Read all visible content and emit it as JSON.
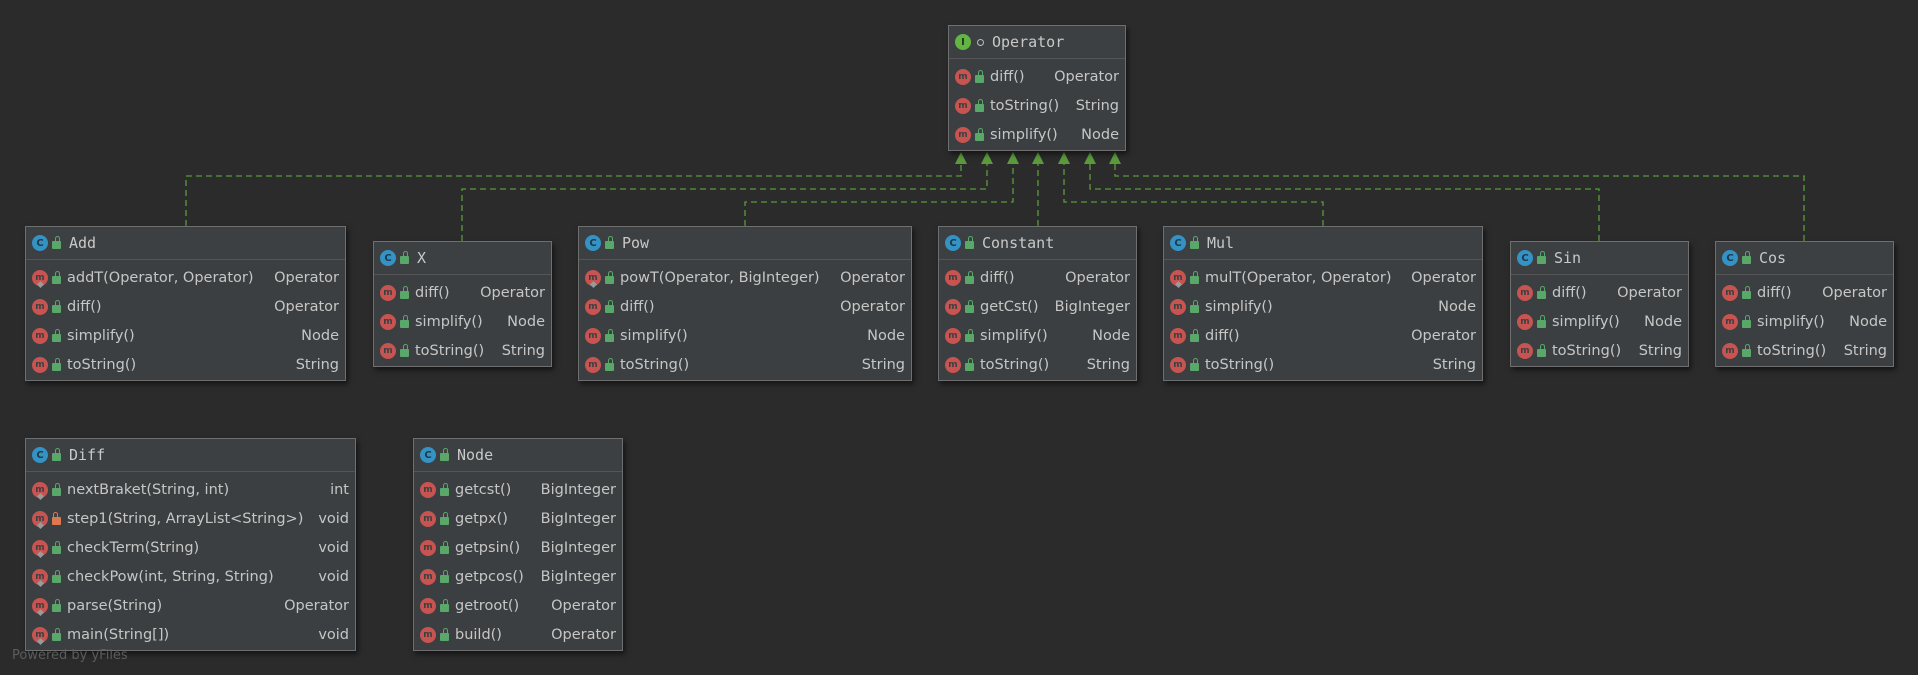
{
  "colors": {
    "background": "#2b2b2b",
    "node_fill": "#3c3f41",
    "node_border": "#6f6f6f",
    "edge": "#5a9a3c",
    "method_icon": "#c75450",
    "class_icon": "#3592c4",
    "interface_icon": "#62b543",
    "public_marker": "#59a869",
    "private_marker": "#e0784f"
  },
  "footer": "Powered by yFiles",
  "nodes": [
    {
      "id": "operator",
      "kind": "I",
      "visibility": "interface",
      "title": "Operator",
      "members": [
        {
          "name": "diff()",
          "type": "Operator",
          "vis": "pub",
          "static": false
        },
        {
          "name": "toString()",
          "type": "String",
          "vis": "pub",
          "static": false
        },
        {
          "name": "simplify()",
          "type": "Node",
          "vis": "pub",
          "static": false
        }
      ]
    },
    {
      "id": "add",
      "kind": "C",
      "visibility": "pub",
      "title": "Add",
      "members": [
        {
          "name": "addT(Operator, Operator)",
          "type": "Operator",
          "vis": "pub",
          "static": true
        },
        {
          "name": "diff()",
          "type": "Operator",
          "vis": "pub",
          "static": false
        },
        {
          "name": "simplify()",
          "type": "Node",
          "vis": "pub",
          "static": false
        },
        {
          "name": "toString()",
          "type": "String",
          "vis": "pub",
          "static": false
        }
      ]
    },
    {
      "id": "x",
      "kind": "C",
      "visibility": "pub",
      "title": "X",
      "members": [
        {
          "name": "diff()",
          "type": "Operator",
          "vis": "pub",
          "static": false
        },
        {
          "name": "simplify()",
          "type": "Node",
          "vis": "pub",
          "static": false
        },
        {
          "name": "toString()",
          "type": "String",
          "vis": "pub",
          "static": false
        }
      ]
    },
    {
      "id": "pow",
      "kind": "C",
      "visibility": "pub",
      "title": "Pow",
      "members": [
        {
          "name": "powT(Operator, BigInteger)",
          "type": "Operator",
          "vis": "pub",
          "static": true
        },
        {
          "name": "diff()",
          "type": "Operator",
          "vis": "pub",
          "static": false
        },
        {
          "name": "simplify()",
          "type": "Node",
          "vis": "pub",
          "static": false
        },
        {
          "name": "toString()",
          "type": "String",
          "vis": "pub",
          "static": false
        }
      ]
    },
    {
      "id": "constant",
      "kind": "C",
      "visibility": "pub",
      "title": "Constant",
      "members": [
        {
          "name": "diff()",
          "type": "Operator",
          "vis": "pub",
          "static": false
        },
        {
          "name": "getCst()",
          "type": "BigInteger",
          "vis": "pub",
          "static": false
        },
        {
          "name": "simplify()",
          "type": "Node",
          "vis": "pub",
          "static": false
        },
        {
          "name": "toString()",
          "type": "String",
          "vis": "pub",
          "static": false
        }
      ]
    },
    {
      "id": "mul",
      "kind": "C",
      "visibility": "pub",
      "title": "Mul",
      "members": [
        {
          "name": "mulT(Operator, Operator)",
          "type": "Operator",
          "vis": "pub",
          "static": true
        },
        {
          "name": "simplify()",
          "type": "Node",
          "vis": "pub",
          "static": false
        },
        {
          "name": "diff()",
          "type": "Operator",
          "vis": "pub",
          "static": false
        },
        {
          "name": "toString()",
          "type": "String",
          "vis": "pub",
          "static": false
        }
      ]
    },
    {
      "id": "sin",
      "kind": "C",
      "visibility": "pub",
      "title": "Sin",
      "members": [
        {
          "name": "diff()",
          "type": "Operator",
          "vis": "pub",
          "static": false
        },
        {
          "name": "simplify()",
          "type": "Node",
          "vis": "pub",
          "static": false
        },
        {
          "name": "toString()",
          "type": "String",
          "vis": "pub",
          "static": false
        }
      ]
    },
    {
      "id": "cos",
      "kind": "C",
      "visibility": "pub",
      "title": "Cos",
      "members": [
        {
          "name": "diff()",
          "type": "Operator",
          "vis": "pub",
          "static": false
        },
        {
          "name": "simplify()",
          "type": "Node",
          "vis": "pub",
          "static": false
        },
        {
          "name": "toString()",
          "type": "String",
          "vis": "pub",
          "static": false
        }
      ]
    },
    {
      "id": "diff",
      "kind": "C",
      "visibility": "pub",
      "title": "Diff",
      "members": [
        {
          "name": "nextBraket(String, int)",
          "type": "int",
          "vis": "pub",
          "static": true
        },
        {
          "name": "step1(String, ArrayList<String>)",
          "type": "void",
          "vis": "priv",
          "static": true
        },
        {
          "name": "checkTerm(String)",
          "type": "void",
          "vis": "pub",
          "static": true
        },
        {
          "name": "checkPow(int, String, String)",
          "type": "void",
          "vis": "pub",
          "static": true
        },
        {
          "name": "parse(String)",
          "type": "Operator",
          "vis": "pub",
          "static": true
        },
        {
          "name": "main(String[])",
          "type": "void",
          "vis": "pub",
          "static": true
        }
      ]
    },
    {
      "id": "node",
      "kind": "C",
      "visibility": "pub",
      "title": "Node",
      "members": [
        {
          "name": "getcst()",
          "type": "BigInteger",
          "vis": "pub",
          "static": false
        },
        {
          "name": "getpx()",
          "type": "BigInteger",
          "vis": "pub",
          "static": false
        },
        {
          "name": "getpsin()",
          "type": "BigInteger",
          "vis": "pub",
          "static": false
        },
        {
          "name": "getpcos()",
          "type": "BigInteger",
          "vis": "pub",
          "static": false
        },
        {
          "name": "getroot()",
          "type": "Operator",
          "vis": "pub",
          "static": false
        },
        {
          "name": "build()",
          "type": "Operator",
          "vis": "pub",
          "static": false
        }
      ]
    }
  ],
  "edges": [
    {
      "from": "add",
      "to": "operator",
      "relation": "implements"
    },
    {
      "from": "x",
      "to": "operator",
      "relation": "implements"
    },
    {
      "from": "pow",
      "to": "operator",
      "relation": "implements"
    },
    {
      "from": "constant",
      "to": "operator",
      "relation": "implements"
    },
    {
      "from": "mul",
      "to": "operator",
      "relation": "implements"
    },
    {
      "from": "sin",
      "to": "operator",
      "relation": "implements"
    },
    {
      "from": "cos",
      "to": "operator",
      "relation": "implements"
    }
  ]
}
